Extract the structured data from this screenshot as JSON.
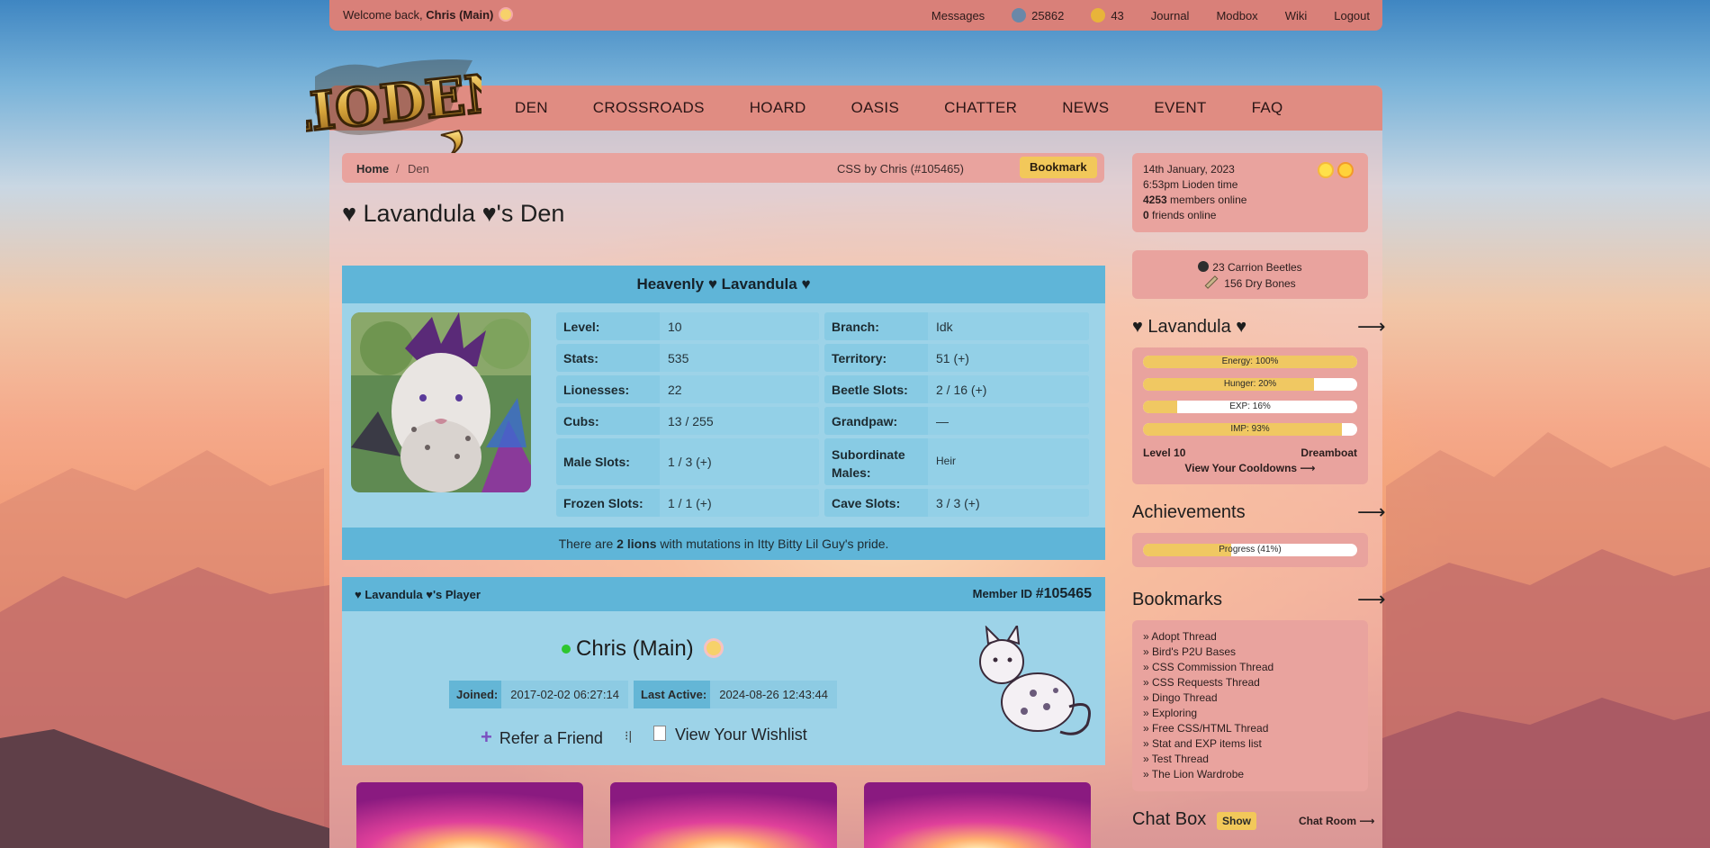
{
  "topbar": {
    "welcome_prefix": "Welcome back,",
    "user": "Chris (Main)",
    "messages": "Messages",
    "beetles_count": "25862",
    "bones_count": "43",
    "journal": "Journal",
    "modbox": "Modbox",
    "wiki": "Wiki",
    "logout": "Logout"
  },
  "logo": {
    "text": "LIODEN"
  },
  "nav": [
    "DEN",
    "CROSSROADS",
    "HOARD",
    "OASIS",
    "CHATTER",
    "NEWS",
    "EVENT",
    "FAQ"
  ],
  "breadcrumb": {
    "home": "Home",
    "sep": "/",
    "current": "Den",
    "css_credit": "CSS by Chris (#105465)",
    "bookmark": "Bookmark"
  },
  "page_title": "♥ Lavandula ♥'s Den",
  "lion": {
    "name": "Heavenly ♥ Lavandula ♥",
    "stats": [
      {
        "k": "Level:",
        "v": "10"
      },
      {
        "k": "Branch:",
        "v": "Idk"
      },
      {
        "k": "Stats:",
        "v": "535"
      },
      {
        "k": "Territory:",
        "v": "51 (+)"
      },
      {
        "k": "Lionesses:",
        "v": "22"
      },
      {
        "k": "Beetle Slots:",
        "v": "2 / 16 (+)"
      },
      {
        "k": "Cubs:",
        "v": "13 / 255"
      },
      {
        "k": "Grandpaw:",
        "v": "—"
      },
      {
        "k": "Male Slots:",
        "v": "1 / 3 (+)"
      },
      {
        "k": "Subordinate Males:",
        "v": "Heir"
      },
      {
        "k": "Frozen Slots:",
        "v": "1 / 1 (+)"
      },
      {
        "k": "Cave Slots:",
        "v": "3 / 3 (+)"
      }
    ],
    "mutations_pre": "There are ",
    "mutations_bold": "2 lions",
    "mutations_post": " with mutations in Itty Bitty Lil Guy's pride."
  },
  "player": {
    "header": "♥ Lavandula ♥'s Player",
    "member_label": "Member ID",
    "member_id": "#105465",
    "name": "Chris (Main)",
    "joined_label": "Joined:",
    "joined": "2017-02-02 06:27:14",
    "last_active_label": "Last Active:",
    "last_active": "2024-08-26 12:43:44",
    "refer": "Refer a Friend",
    "wishlist": "View Your Wishlist"
  },
  "sidebar": {
    "date": "14th January, 2023",
    "time": "6:53pm Lioden time",
    "members_online_num": "4253",
    "members_online_text": "members online",
    "friends_online_num": "0",
    "friends_online_text": "friends online",
    "beetles": "23 Carrion Beetles",
    "bones": "156 Dry Bones",
    "lion_heading": "♥ Lavandula ♥",
    "bars": [
      {
        "label": "Energy: 100%",
        "value": 100
      },
      {
        "label": "Hunger: 20%",
        "value": 80
      },
      {
        "label": "EXP: 16%",
        "value": 16
      },
      {
        "label": "IMP: 93%",
        "value": 93
      }
    ],
    "level": "Level 10",
    "title": "Dreamboat",
    "cooldowns": "View Your Cooldowns ⟶",
    "achievements_heading": "Achievements",
    "progress_label": "Progress (41%)",
    "progress_value": 41,
    "bookmarks_heading": "Bookmarks",
    "bookmarks": [
      "» Adopt Thread",
      "» Bird's P2U Bases",
      "» CSS Commission Thread",
      "» CSS Requests Thread",
      "» Dingo Thread",
      "» Exploring",
      "» Free CSS/HTML Thread",
      "» Stat and EXP items list",
      "» Test Thread",
      "» The Lion Wardrobe"
    ],
    "chatbox_heading": "Chat Box",
    "show": "Show",
    "chatroom": "Chat Room ⟶",
    "arrow": "⟶"
  },
  "colors": {
    "topbar": "#d98079",
    "panel_accent": "#e08c82",
    "lion_header": "#5fb5d8",
    "lion_body": "#9dd3e8",
    "button_gold": "#f2c85a"
  }
}
